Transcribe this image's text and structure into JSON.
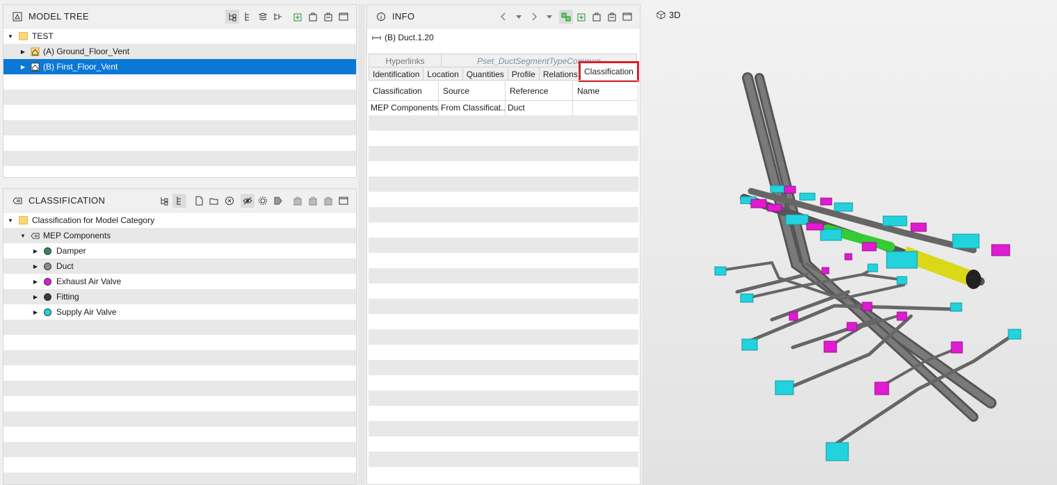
{
  "model_tree": {
    "title": "MODEL TREE",
    "items": [
      {
        "label": "TEST"
      },
      {
        "label": "(A) Ground_Floor_Vent"
      },
      {
        "label": "(B) First_Floor_Vent"
      }
    ]
  },
  "classification": {
    "title": "CLASSIFICATION",
    "root": "Classification for Model Category",
    "group": "MEP Components",
    "items": [
      {
        "label": "Damper",
        "color": "#2e8b57"
      },
      {
        "label": "Duct",
        "color": "#8a8a8a"
      },
      {
        "label": "Exhaust Air Valve",
        "color": "#e01bd1"
      },
      {
        "label": "Fitting",
        "color": "#3a3a3a"
      },
      {
        "label": "Supply Air Valve",
        "color": "#22d3dd"
      }
    ]
  },
  "info": {
    "title": "INFO",
    "object": "(B) Duct.1.20",
    "tabs_row1": [
      "Hyperlinks",
      "Pset_DuctSegmentTypeCommon"
    ],
    "tabs_row2": [
      "Identification",
      "Location",
      "Quantities",
      "Profile",
      "Relations",
      "Classification"
    ],
    "columns": [
      "Classification",
      "Source",
      "Reference",
      "Name"
    ],
    "rows": [
      [
        "MEP Components",
        "From Classificat...",
        "Duct",
        ""
      ]
    ]
  },
  "view3d": {
    "title": "3D"
  },
  "colors": {
    "selection": "#0c78d6",
    "highlight_box": "#d9202a",
    "duct": "#6f6f6f",
    "supply": "#22d3dd",
    "exhaust": "#e01bd1",
    "damper_green": "#33cc33",
    "yellow": "#e6e619"
  }
}
